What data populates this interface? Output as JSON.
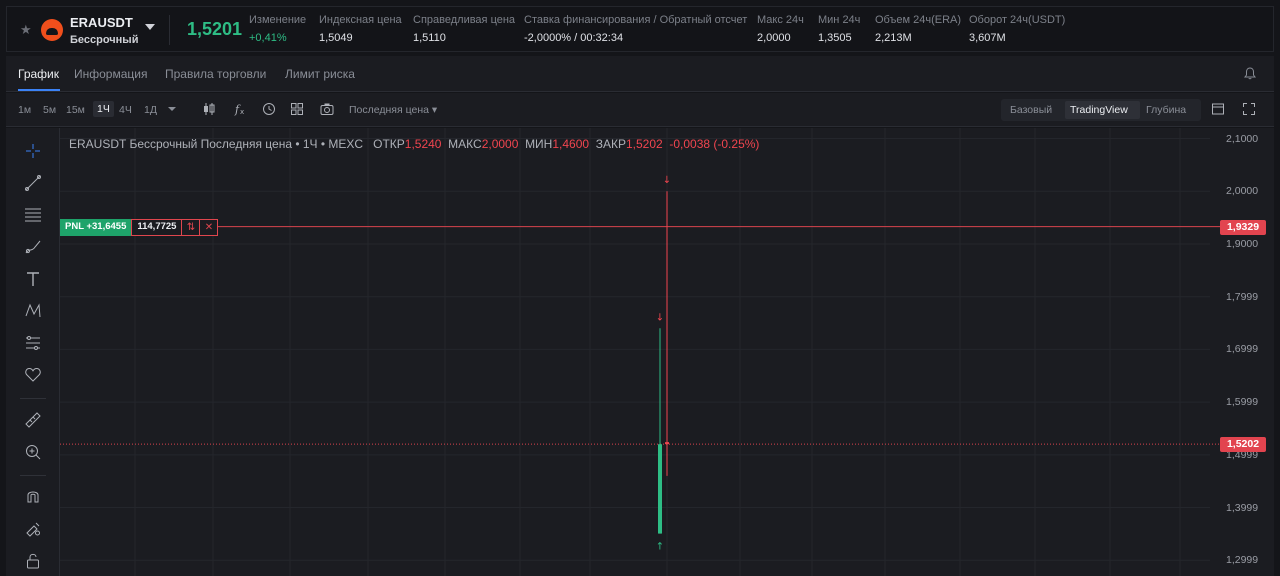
{
  "header": {
    "symbol": "ERAUSDT",
    "contract_type": "Бессрочный",
    "last_price": "1,5201",
    "stats": [
      {
        "label": "Изменение",
        "value": "+0,41%"
      },
      {
        "label": "Индексная цена",
        "value": "1,5049"
      },
      {
        "label": "Справедливая цена",
        "value": "1,5110"
      },
      {
        "label": "Ставка финансирования / Обратный отсчет",
        "value": "-2,0000% / 00:32:34"
      },
      {
        "label": "Макс 24ч",
        "value": "2,0000"
      },
      {
        "label": "Мин 24ч",
        "value": "1,3505"
      },
      {
        "label": "Объем 24ч(ERA)",
        "value": "2,213M"
      },
      {
        "label": "Оборот 24ч(USDT)",
        "value": "3,607M"
      }
    ]
  },
  "tabs": [
    "График",
    "Информация",
    "Правила торговли",
    "Лимит риска"
  ],
  "toolbar": {
    "timeframes": [
      "1м",
      "5м",
      "15м",
      "1Ч",
      "4Ч",
      "1Д"
    ],
    "active_timeframe": "1Ч",
    "price_type": "Последняя цена",
    "views": [
      "Базовый",
      "TradingView",
      "Глубина"
    ],
    "active_view": "TradingView"
  },
  "legend": {
    "title": "ERAUSDT Бессрочный Последняя цена • 1Ч • MEXC",
    "open_label": "ОТКР",
    "open": "1,5240",
    "high_label": "МАКС",
    "high": "2,0000",
    "low_label": "МИН",
    "low": "1,4600",
    "close_label": "ЗАКР",
    "close": "1,5202",
    "change": "-0,0038 (-0.25%)"
  },
  "position": {
    "pnl_label": "PNL +31,6455",
    "quantity": "114,7725",
    "entry_price_tag": "1,9329"
  },
  "current_price_tag": "1,5202",
  "colors": {
    "up": "#2ebd85",
    "down": "#f0454f",
    "accent": "#3b82f6"
  },
  "chart_data": {
    "type": "candlestick",
    "y_axis_labels": [
      "2,1000",
      "2,0000",
      "1,9000",
      "1,7999",
      "1,6999",
      "1,5999",
      "1,4999",
      "1,3999",
      "1,2999"
    ],
    "ylim": [
      1.27,
      2.12
    ],
    "grid": true,
    "candles": [
      {
        "open": 1.3505,
        "high": 1.74,
        "low": 1.3505,
        "close": 1.52,
        "color": "up"
      },
      {
        "open": 1.524,
        "high": 2.0,
        "low": 1.46,
        "close": 1.5202,
        "color": "down"
      }
    ],
    "horizontal_lines": [
      {
        "price": 1.9329,
        "style": "solid",
        "label": "1,9329"
      },
      {
        "price": 1.5202,
        "style": "dotted",
        "label": "1,5202"
      }
    ]
  }
}
